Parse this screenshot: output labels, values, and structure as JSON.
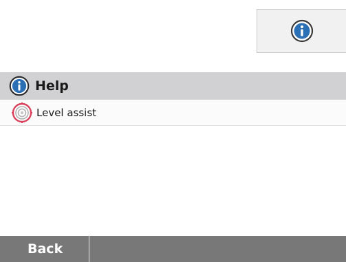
{
  "top": {
    "info_button_icon": "info-icon"
  },
  "menu": {
    "header": {
      "icon": "info-icon",
      "title": "Help"
    },
    "items": [
      {
        "icon": "level-target-icon",
        "label": "Level assist"
      }
    ]
  },
  "bottom_bar": {
    "back_label": "Back"
  },
  "colors": {
    "header_bg": "#d1d1d3",
    "bottom_bar_bg": "#787878",
    "info_icon_blue": "#2b6fb5",
    "level_icon_red": "#d9415c"
  }
}
